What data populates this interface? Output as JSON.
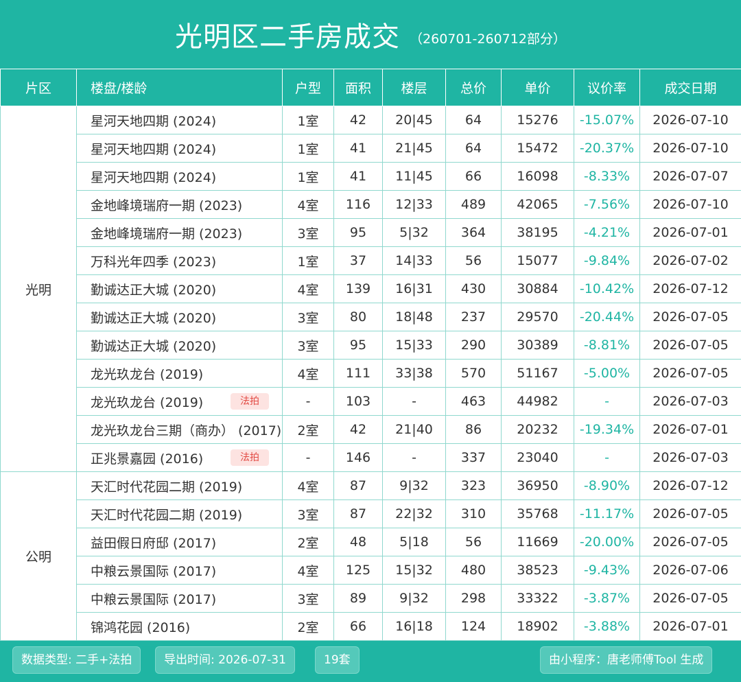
{
  "header": {
    "title": "光明区二手房成交",
    "subtitle": "（260701-260712部分）"
  },
  "table": {
    "columns": [
      "片区",
      "楼盘/楼龄",
      "户型",
      "面积",
      "楼层",
      "总价",
      "单价",
      "议价率",
      "成交日期"
    ],
    "groups": [
      {
        "region": "光明",
        "rows": [
          {
            "name": "星河天地四期 (2024)",
            "badge": "",
            "type": "1室",
            "area": "42",
            "floor": "20|45",
            "total": "64",
            "unit": "15276",
            "rate": "-15.07%",
            "date": "2026-07-10"
          },
          {
            "name": "星河天地四期 (2024)",
            "badge": "",
            "type": "1室",
            "area": "41",
            "floor": "21|45",
            "total": "64",
            "unit": "15472",
            "rate": "-20.37%",
            "date": "2026-07-10"
          },
          {
            "name": "星河天地四期 (2024)",
            "badge": "",
            "type": "1室",
            "area": "41",
            "floor": "11|45",
            "total": "66",
            "unit": "16098",
            "rate": "-8.33%",
            "date": "2026-07-07"
          },
          {
            "name": "金地峰境瑞府一期 (2023)",
            "badge": "",
            "type": "4室",
            "area": "116",
            "floor": "12|33",
            "total": "489",
            "unit": "42065",
            "rate": "-7.56%",
            "date": "2026-07-10"
          },
          {
            "name": "金地峰境瑞府一期 (2023)",
            "badge": "",
            "type": "3室",
            "area": "95",
            "floor": "5|32",
            "total": "364",
            "unit": "38195",
            "rate": "-4.21%",
            "date": "2026-07-01"
          },
          {
            "name": "万科光年四季 (2023)",
            "badge": "",
            "type": "1室",
            "area": "37",
            "floor": "14|33",
            "total": "56",
            "unit": "15077",
            "rate": "-9.84%",
            "date": "2026-07-02"
          },
          {
            "name": "勤诚达正大城 (2020)",
            "badge": "",
            "type": "4室",
            "area": "139",
            "floor": "16|31",
            "total": "430",
            "unit": "30884",
            "rate": "-10.42%",
            "date": "2026-07-12"
          },
          {
            "name": "勤诚达正大城 (2020)",
            "badge": "",
            "type": "3室",
            "area": "80",
            "floor": "18|48",
            "total": "237",
            "unit": "29570",
            "rate": "-20.44%",
            "date": "2026-07-05"
          },
          {
            "name": "勤诚达正大城 (2020)",
            "badge": "",
            "type": "3室",
            "area": "95",
            "floor": "15|33",
            "total": "290",
            "unit": "30389",
            "rate": "-8.81%",
            "date": "2026-07-05"
          },
          {
            "name": "龙光玖龙台 (2019)",
            "badge": "",
            "type": "4室",
            "area": "111",
            "floor": "33|38",
            "total": "570",
            "unit": "51167",
            "rate": "-5.00%",
            "date": "2026-07-05"
          },
          {
            "name": "龙光玖龙台 (2019)",
            "badge": "法拍",
            "type": "-",
            "area": "103",
            "floor": "-",
            "total": "463",
            "unit": "44982",
            "rate": "-",
            "date": "2026-07-03"
          },
          {
            "name": "龙光玖龙台三期（商办） (2017)",
            "badge": "",
            "type": "2室",
            "area": "42",
            "floor": "21|40",
            "total": "86",
            "unit": "20232",
            "rate": "-19.34%",
            "date": "2026-07-01"
          },
          {
            "name": "正兆景嘉园 (2016)",
            "badge": "法拍",
            "type": "-",
            "area": "146",
            "floor": "-",
            "total": "337",
            "unit": "23040",
            "rate": "-",
            "date": "2026-07-03"
          }
        ]
      },
      {
        "region": "公明",
        "rows": [
          {
            "name": "天汇时代花园二期 (2019)",
            "badge": "",
            "type": "4室",
            "area": "87",
            "floor": "9|32",
            "total": "323",
            "unit": "36950",
            "rate": "-8.90%",
            "date": "2026-07-12"
          },
          {
            "name": "天汇时代花园二期 (2019)",
            "badge": "",
            "type": "3室",
            "area": "87",
            "floor": "22|32",
            "total": "310",
            "unit": "35768",
            "rate": "-11.17%",
            "date": "2026-07-05"
          },
          {
            "name": "益田假日府邸 (2017)",
            "badge": "",
            "type": "2室",
            "area": "48",
            "floor": "5|18",
            "total": "56",
            "unit": "11669",
            "rate": "-20.00%",
            "date": "2026-07-05"
          },
          {
            "name": "中粮云景国际 (2017)",
            "badge": "",
            "type": "4室",
            "area": "125",
            "floor": "15|32",
            "total": "480",
            "unit": "38523",
            "rate": "-9.43%",
            "date": "2026-07-06"
          },
          {
            "name": "中粮云景国际 (2017)",
            "badge": "",
            "type": "3室",
            "area": "89",
            "floor": "9|32",
            "total": "298",
            "unit": "33322",
            "rate": "-3.87%",
            "date": "2026-07-05"
          },
          {
            "name": "锦鸿花园 (2016)",
            "badge": "",
            "type": "2室",
            "area": "66",
            "floor": "16|18",
            "total": "124",
            "unit": "18902",
            "rate": "-3.88%",
            "date": "2026-07-01"
          }
        ]
      }
    ]
  },
  "footer": {
    "data_type": "数据类型: 二手+法拍",
    "export_time": "导出时间: 2026-07-31",
    "count": "19套",
    "generated_by": "由小程序：唐老师傅Tool 生成"
  },
  "colors": {
    "accent": "#1fb5a3",
    "rate_text": "#1fb5a3",
    "badge_bg": "#fde3e1",
    "badge_text": "#e24a43"
  }
}
